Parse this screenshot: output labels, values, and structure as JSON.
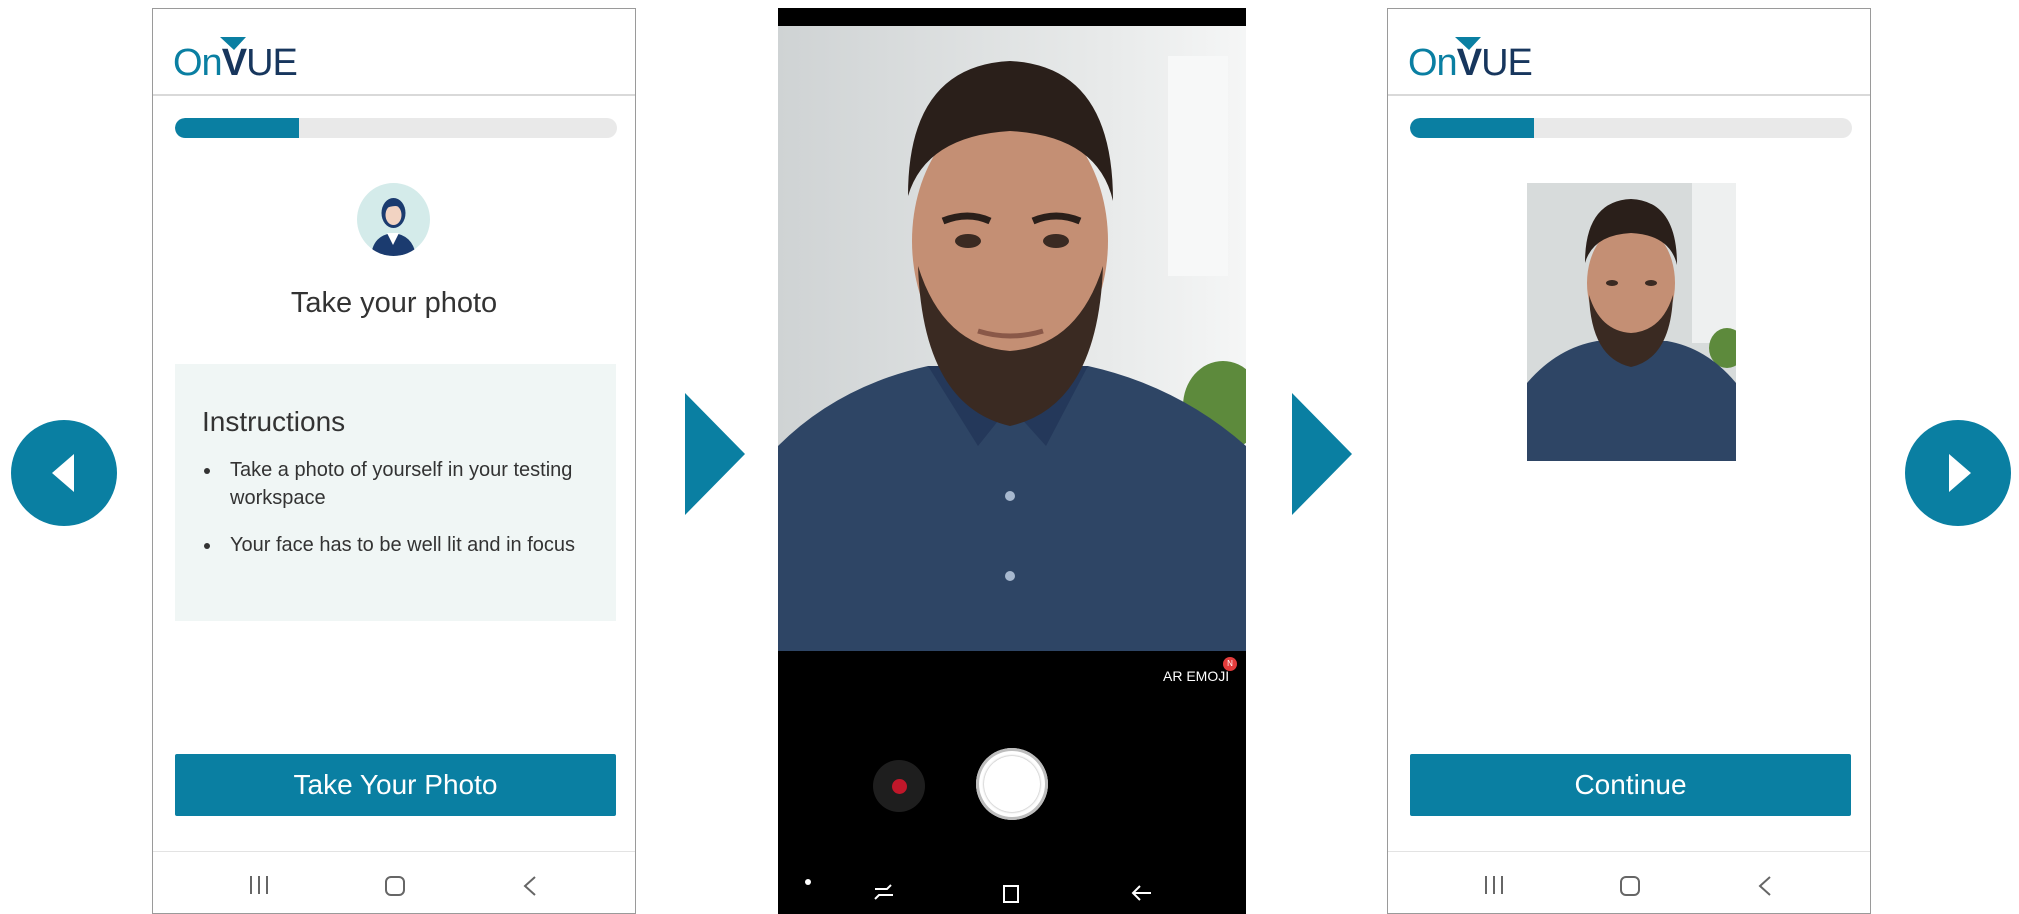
{
  "carousel": {
    "prev_label": "previous",
    "next_label": "next",
    "accent_color": "#0a7fa2"
  },
  "logo": {
    "on": "On",
    "v": "V",
    "ue": "UE"
  },
  "screen1": {
    "progress_fraction": 0.28,
    "title": "Take your photo",
    "instructions_title": "Instructions",
    "instructions": [
      "Take a photo of yourself in your testing workspace",
      "Your face has to be well lit and in focus"
    ],
    "button_label": "Take Your Photo"
  },
  "camera": {
    "ar_label": "AR EMOJI",
    "ar_badge": "N"
  },
  "screen3": {
    "progress_fraction": 0.28,
    "button_label": "Continue"
  },
  "colors": {
    "primary": "#0a7fa2",
    "navy": "#17365d",
    "panel": "#f0f6f5",
    "track": "#e9e9e9"
  },
  "icons": [
    "triangle-left-icon",
    "triangle-right-icon",
    "play-arrow-icon",
    "avatar-icon",
    "recent-apps-icon",
    "home-icon",
    "back-icon"
  ]
}
